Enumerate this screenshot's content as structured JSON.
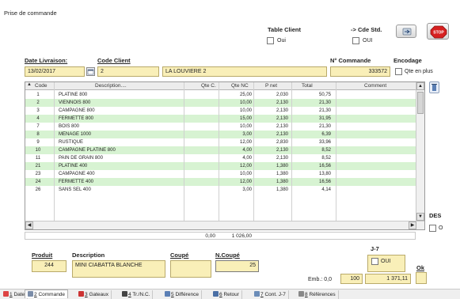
{
  "window": {
    "title": "Prise de commande"
  },
  "header": {
    "table_client_label": "Table Client",
    "table_client_oui": "Oui",
    "cde_std_label": "-> Cde Std.",
    "cde_std_oui": "OUI"
  },
  "form": {
    "date_livraison_label": "Date Livraison:",
    "date_livraison_value": "13/02/2017",
    "code_client_label": "Code Client",
    "code_client_value": "2",
    "client_name_value": "LA LOUVIERE 2",
    "num_commande_label": "N° Commande",
    "num_commande_value": "333572",
    "encodage_label": "Encodage",
    "qte_en_plus_label": "Qte en plus"
  },
  "table": {
    "columns": [
      "Code",
      "Description....",
      "Qte C.",
      "Qte NC",
      "P net",
      "Total",
      "Comment"
    ],
    "rows": [
      {
        "code": "1",
        "desc": "PLATINE 800",
        "qc": "",
        "qnc": "25,00",
        "pnet": "2,030",
        "total": "50,75"
      },
      {
        "code": "2",
        "desc": "VIENNOIS 800",
        "qc": "",
        "qnc": "10,00",
        "pnet": "2,130",
        "total": "21,30"
      },
      {
        "code": "3",
        "desc": "CAMPAGNE 800",
        "qc": "",
        "qnc": "10,00",
        "pnet": "2,130",
        "total": "21,30"
      },
      {
        "code": "4",
        "desc": "FERMETTE 800",
        "qc": "",
        "qnc": "15,00",
        "pnet": "2,130",
        "total": "31,95"
      },
      {
        "code": "7",
        "desc": "BOIS 800",
        "qc": "",
        "qnc": "10,00",
        "pnet": "2,130",
        "total": "21,30"
      },
      {
        "code": "8",
        "desc": "MENAGE 1000",
        "qc": "",
        "qnc": "3,00",
        "pnet": "2,130",
        "total": "6,39"
      },
      {
        "code": "9",
        "desc": "RUSTIQUE",
        "qc": "",
        "qnc": "12,00",
        "pnet": "2,830",
        "total": "33,96"
      },
      {
        "code": "10",
        "desc": "CAMPAGNE PLATINE 800",
        "qc": "",
        "qnc": "4,00",
        "pnet": "2,130",
        "total": "8,52"
      },
      {
        "code": "11",
        "desc": "PAIN DE GRAIN 800",
        "qc": "",
        "qnc": "4,00",
        "pnet": "2,130",
        "total": "8,52"
      },
      {
        "code": "21",
        "desc": "PLATINE 400",
        "qc": "",
        "qnc": "12,00",
        "pnet": "1,380",
        "total": "16,56"
      },
      {
        "code": "23",
        "desc": "CAMPAGNE 400",
        "qc": "",
        "qnc": "10,00",
        "pnet": "1,380",
        "total": "13,80"
      },
      {
        "code": "24",
        "desc": "FERMETTE 400",
        "qc": "",
        "qnc": "12,00",
        "pnet": "1,380",
        "total": "16,56"
      },
      {
        "code": "26",
        "desc": "SANS SEL 400",
        "qc": "",
        "qnc": "3,00",
        "pnet": "1,380",
        "total": "4,14"
      }
    ],
    "totals": {
      "qc": "0,00",
      "qnc": "1 026,00"
    }
  },
  "side": {
    "des_label": "DES",
    "o_label": "O"
  },
  "bottom": {
    "produit_label": "Produit",
    "produit_value": "244",
    "description_label": "Description",
    "description_value": "MINI CIABATTA BLANCHE",
    "coupe_label": "Coupé",
    "ncoupe_label": "N.Coupé",
    "ncoupe_value": "25",
    "j7_label": "J-7",
    "j7_oui": "OUI",
    "ok_label": "Ok",
    "emb_label": "Emb.: 0,0",
    "emb_qty": "100",
    "grand_total": "1 371,11"
  },
  "tabs": [
    {
      "num": "1",
      "label": "Date"
    },
    {
      "num": "2",
      "label": "Commande"
    },
    {
      "num": "3",
      "label": "Gateaux"
    },
    {
      "num": "4",
      "label": "Tr./N.C."
    },
    {
      "num": "5",
      "label": "Différence"
    },
    {
      "num": "6",
      "label": "Retour"
    },
    {
      "num": "7",
      "label": "Cont. J-7"
    },
    {
      "num": "8",
      "label": "Références"
    }
  ],
  "icons": {
    "refresh": "refresh-icon",
    "stop": "stop-icon",
    "calendar": "calendar-icon",
    "delete": "trash-icon"
  },
  "colors": {
    "field_bg": "#f9efb8",
    "row_highlight": "#d7f3d2",
    "stop_red": "#d62020"
  }
}
